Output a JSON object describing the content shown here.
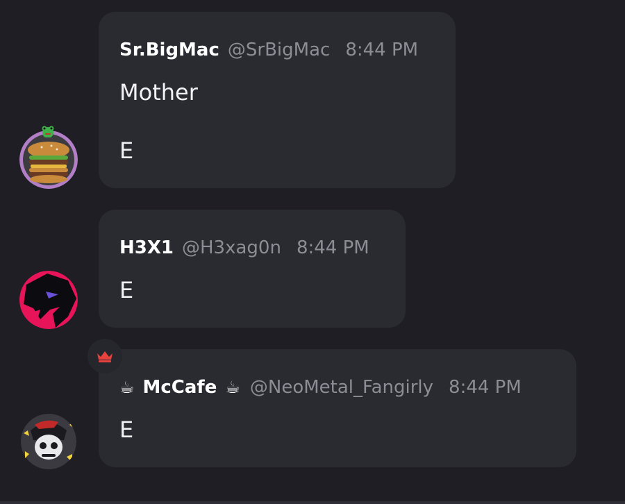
{
  "messages": [
    {
      "display_name": "Sr.BigMac",
      "handle": "@SrBigMac",
      "time": "8:44 PM",
      "lines": [
        "Mother",
        "E"
      ],
      "avatar_icon": "big-mac-burger-avatar"
    },
    {
      "display_name": "H3X1",
      "handle": "@H3xag0n",
      "time": "8:44 PM",
      "lines": [
        "E"
      ],
      "avatar_icon": "dark-creature-avatar"
    },
    {
      "display_name": "McCafe",
      "name_prefix_emoji": "☕",
      "name_suffix_emoji": "☕",
      "handle": "@NeoMetal_Fangirly",
      "time": "8:44 PM",
      "lines": [
        "E"
      ],
      "avatar_icon": "anime-character-avatar",
      "badge_icon": "crown-icon"
    }
  ],
  "colors": {
    "background": "#1e1e24",
    "bubble": "#2a2a31",
    "name": "#ffffff",
    "meta": "#8d8d95",
    "crown": "#e8423f"
  }
}
